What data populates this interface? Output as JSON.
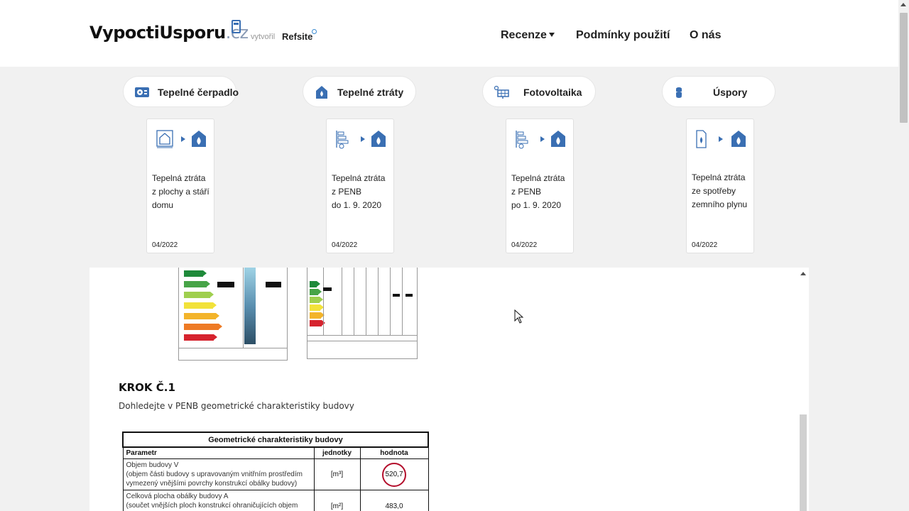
{
  "header": {
    "logo_main": "VypoctiUsporu",
    "logo_tld": ".cz",
    "by_label": "vytvořil",
    "partner": "Refsite",
    "nav": [
      {
        "label": "Recenze",
        "has_dropdown": true
      },
      {
        "label": "Podmínky použití"
      },
      {
        "label": "O nás"
      }
    ]
  },
  "categories": [
    {
      "label": "Tepelné čerpadlo",
      "icon": "heat-pump-icon"
    },
    {
      "label": "Tepelné ztráty",
      "icon": "house-flame-icon"
    },
    {
      "label": "Fotovoltaika",
      "icon": "solar-panel-icon"
    },
    {
      "label": "Úspory",
      "icon": "coins-icon"
    }
  ],
  "cards": [
    {
      "title": "Tepelná ztráta\nz plochy a stáří\ndomu",
      "date": "04/2022",
      "icon": "house-plan-icon"
    },
    {
      "title": "Tepelná ztráta\nz PENB\ndo 1. 9. 2020",
      "date": "04/2022",
      "icon": "energy-label-icon"
    },
    {
      "title": "Tepelná ztráta\nz PENB\npo 1. 9. 2020",
      "date": "04/2022",
      "icon": "energy-label-icon"
    },
    {
      "title": "Tepelná ztráta\nze spotřeby\nzemního plynu",
      "date": "04/2022",
      "icon": "gas-document-icon"
    }
  ],
  "article": {
    "step_title": "KROK Č.1",
    "step_desc": "Dohledejte v PENB geometrické charakteristiky budovy",
    "table": {
      "caption": "Geometrické charakteristiky budovy",
      "headers": [
        "Parametr",
        "jednotky",
        "hodnota"
      ],
      "rows": [
        {
          "param_1": "Objem budovy V",
          "param_2": "(objem části budovy s upravovaným vnitřním prostředím",
          "param_3": "vymezený vnějšími povrchy konstrukcí obálky budovy)",
          "unit": "[m³]",
          "value": "520,7"
        },
        {
          "param_1": "Celková plocha obálky budovy A",
          "param_2": "(součet vnějších ploch konstrukcí ohraničujících objem",
          "unit": "[m²]",
          "value": "483,0"
        }
      ]
    }
  },
  "colors": {
    "accent_blue": "#3a6fb3",
    "highlight_red": "#b30d2b"
  }
}
